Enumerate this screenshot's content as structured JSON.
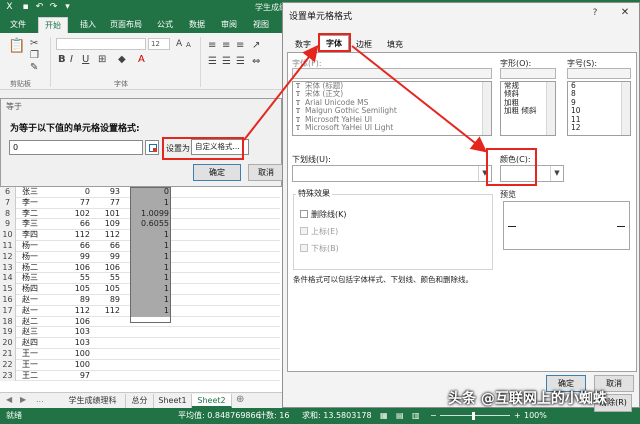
{
  "window": {
    "title": "学生成绩（兼容模式） - Excel"
  },
  "ribbon": {
    "tabs": [
      "文件",
      "开始",
      "插入",
      "页面布局",
      "公式",
      "数据",
      "审阅",
      "视图"
    ],
    "active_tab": "开始",
    "groups": [
      "剪贴板",
      "字体"
    ],
    "font_size": "12"
  },
  "sheet": {
    "rows": [
      {
        "n": "6",
        "a": "张三",
        "b": "0",
        "c": "93",
        "d": "0"
      },
      {
        "n": "7",
        "a": "李一",
        "b": "77",
        "c": "77",
        "d": "1"
      },
      {
        "n": "8",
        "a": "李二",
        "b": "102",
        "c": "101",
        "d": "1.0099"
      },
      {
        "n": "9",
        "a": "李三",
        "b": "66",
        "c": "109",
        "d": "0.6055"
      },
      {
        "n": "10",
        "a": "李四",
        "b": "112",
        "c": "112",
        "d": "1"
      },
      {
        "n": "11",
        "a": "杨一",
        "b": "66",
        "c": "66",
        "d": "1"
      },
      {
        "n": "12",
        "a": "杨一",
        "b": "99",
        "c": "99",
        "d": "1"
      },
      {
        "n": "13",
        "a": "杨二",
        "b": "106",
        "c": "106",
        "d": "1"
      },
      {
        "n": "14",
        "a": "杨三",
        "b": "55",
        "c": "55",
        "d": "1"
      },
      {
        "n": "15",
        "a": "杨四",
        "b": "105",
        "c": "105",
        "d": "1"
      },
      {
        "n": "16",
        "a": "赵一",
        "b": "89",
        "c": "89",
        "d": "1"
      },
      {
        "n": "17",
        "a": "赵一",
        "b": "112",
        "c": "112",
        "d": "1"
      },
      {
        "n": "18",
        "a": "赵二",
        "b": "106",
        "c": "",
        "d": ""
      },
      {
        "n": "19",
        "a": "赵三",
        "b": "103",
        "c": "",
        "d": ""
      },
      {
        "n": "20",
        "a": "赵四",
        "b": "103",
        "c": "",
        "d": ""
      },
      {
        "n": "21",
        "a": "王一",
        "b": "100",
        "c": "",
        "d": ""
      },
      {
        "n": "22",
        "a": "王一",
        "b": "100",
        "c": "",
        "d": ""
      },
      {
        "n": "23",
        "a": "王二",
        "b": "97",
        "c": "",
        "d": ""
      }
    ],
    "tabs": [
      "学生成绩理科",
      "总分",
      "Sheet1",
      "Sheet2"
    ],
    "active_tab": "Sheet2",
    "nav_more": "...",
    "nav_add": "⊕"
  },
  "statusbar": {
    "mode": "就绪",
    "average": "平均值: 0.848769866",
    "count": "计数: 16",
    "sum": "求和: 13.5803178",
    "zoom": "100%"
  },
  "cf_dialog": {
    "title": "等于",
    "prompt": "为等于以下值的单元格设置格式:",
    "value": "0",
    "set_as_label": "设置为",
    "set_as_value": "自定义格式...",
    "ok": "确定",
    "cancel": "取消"
  },
  "format_dialog": {
    "title": "设置单元格格式",
    "close": "✕",
    "help": "?",
    "tabs": [
      "数字",
      "字体",
      "边框",
      "填充"
    ],
    "active_tab": "字体",
    "font_label": "字体(F):",
    "font_list": [
      {
        "icon": "T",
        "name": "宋体 (标题)"
      },
      {
        "icon": "T",
        "name": "宋体 (正文)"
      },
      {
        "icon": "T",
        "name": "Arial Unicode MS"
      },
      {
        "icon": "T",
        "name": "Malgun Gothic Semilight"
      },
      {
        "icon": "T",
        "name": "Microsoft YaHei UI"
      },
      {
        "icon": "T",
        "name": "Microsoft YaHei UI Light"
      }
    ],
    "style_label": "字形(O):",
    "style_list": [
      "常规",
      "倾斜",
      "加粗",
      "加粗 倾斜"
    ],
    "size_label": "字号(S):",
    "size_list": [
      "6",
      "8",
      "9",
      "10",
      "11",
      "12"
    ],
    "underline_label": "下划线(U):",
    "color_label": "颜色(C):",
    "effects_label": "特殊效果",
    "strikethrough": "删除线(K)",
    "superscript": "上标(E)",
    "subscript": "下标(B)",
    "preview_label": "预览",
    "note": "条件格式可以包括字体样式、下划线、颜色和删除线。",
    "clear": "清除(R)",
    "ok": "确定",
    "cancel": "取消"
  },
  "watermark": "头条 @互联网上的小蜘蛛",
  "colors": {
    "excel_green": "#217346",
    "annotation_red": "#e5261f",
    "selection_gray": "#a9a9a9"
  }
}
